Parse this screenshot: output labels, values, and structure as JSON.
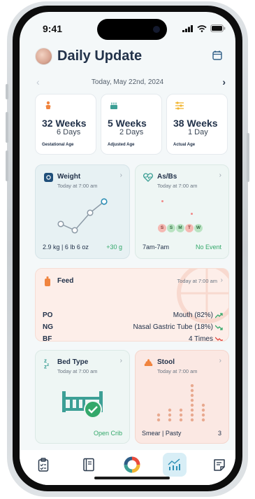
{
  "status": {
    "time": "9:41"
  },
  "header": {
    "title": "Daily Update"
  },
  "date_nav": {
    "date": "Today, May 22nd, 2024"
  },
  "age_cards": [
    {
      "big": "32 Weeks",
      "small": "6 Days",
      "label": "Gestational Age"
    },
    {
      "big": "5 Weeks",
      "small": "2 Days",
      "label": "Adjusted Age"
    },
    {
      "big": "38 Weeks",
      "small": "1 Day",
      "label": "Actual Age"
    }
  ],
  "weight": {
    "title": "Weight",
    "time": "Today at 7:00 am",
    "value": "2.9 kg | 6 lb 6 oz",
    "delta": "+30 g"
  },
  "asbs": {
    "title": "As/Bs",
    "time": "Today at 7:00 am",
    "range": "7am-7am",
    "status": "No Event",
    "markers": [
      "S",
      "S",
      "M",
      "T",
      "W"
    ]
  },
  "feed": {
    "title": "Feed",
    "time": "Today at 7:00 am",
    "rows": [
      {
        "type": "PO",
        "value": "Mouth (82%)",
        "trend": "up"
      },
      {
        "type": "NG",
        "value": "Nasal Gastric Tube (18%)",
        "trend": "down"
      },
      {
        "type": "BF",
        "value": "4 Times",
        "trend": "down"
      }
    ]
  },
  "bed": {
    "title": "Bed Type",
    "time": "Today at 7:00 am",
    "value": "Open Crib"
  },
  "stool": {
    "title": "Stool",
    "time": "Today at 7:00 am",
    "value": "Smear | Pasty",
    "count": "3"
  },
  "colors": {
    "accent_green": "#33a86a",
    "navy": "#22324a",
    "feed_bg": "#fdeee9",
    "icon_orange": "#f0843f",
    "icon_teal": "#3c9f95"
  },
  "nav": [
    "clipboard-icon",
    "journal-icon",
    "app-logo-icon",
    "chart-icon",
    "notes-icon"
  ]
}
